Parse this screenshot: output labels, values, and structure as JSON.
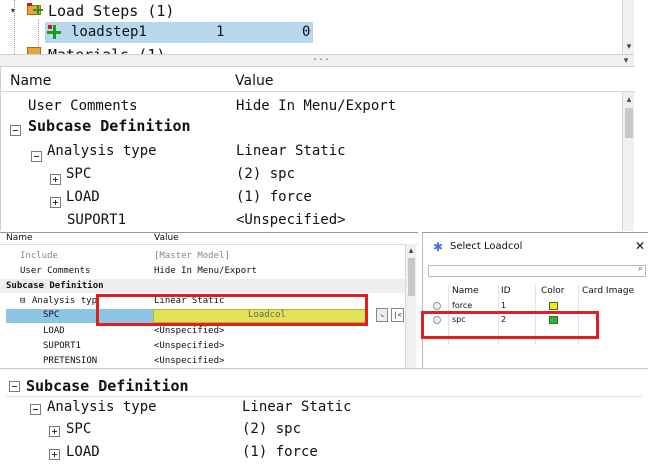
{
  "tree": {
    "load_steps_label": "Load Steps (1)",
    "loadstep_name": "loadstep1",
    "loadstep_id": "1",
    "loadstep_count": "0",
    "materials_label": "Materials (1)",
    "splitter_dots": "..."
  },
  "top_table": {
    "col_name": "Name",
    "col_value": "Value",
    "rows": [
      {
        "name": "User Comments",
        "value": "Hide In Menu/Export"
      },
      {
        "name": "Subcase Definition",
        "value": ""
      },
      {
        "name": "Analysis type",
        "value": "Linear Static"
      },
      {
        "name": "SPC",
        "value": "(2) spc"
      },
      {
        "name": "LOAD",
        "value": "(1) force"
      },
      {
        "name": "SUPORT1",
        "value": "<Unspecified>"
      }
    ]
  },
  "mid_table": {
    "col_name": "Name",
    "col_value": "Value",
    "rows": [
      {
        "name": "Include",
        "value": "[Master Model]"
      },
      {
        "name": "User Comments",
        "value": "Hide In Menu/Export"
      },
      {
        "name": "Subcase Definition",
        "value": ""
      },
      {
        "name": "Analysis type",
        "value": "Linear Static"
      },
      {
        "name": "SPC",
        "value": "Loadcol"
      },
      {
        "name": "LOAD",
        "value": "<Unspecified>"
      },
      {
        "name": "SUPORT1",
        "value": "<Unspecified>"
      },
      {
        "name": "PRETENSION",
        "value": "<Unspecified>"
      }
    ]
  },
  "dialog": {
    "title": "Select Loadcol",
    "close": "✕",
    "search_placeholder": "",
    "cols": [
      "Name",
      "ID",
      "Color",
      "Card Image"
    ],
    "rows": [
      {
        "name": "force",
        "id": "1",
        "color": "#f2ee00"
      },
      {
        "name": "spc",
        "id": "2",
        "color": "#14c814"
      }
    ]
  },
  "bottom_table": {
    "rows": [
      {
        "name": "Subcase Definition",
        "value": ""
      },
      {
        "name": "Analysis type",
        "value": "Linear Static"
      },
      {
        "name": "SPC",
        "value": "(2) spc"
      },
      {
        "name": "LOAD",
        "value": "(1) force"
      }
    ]
  },
  "colors": {
    "highlight_red": "#e02020",
    "selected_blue": "#b7d7ee",
    "spc_blue": "#8ec5e6",
    "yellow_bar": "#e2e25a"
  }
}
